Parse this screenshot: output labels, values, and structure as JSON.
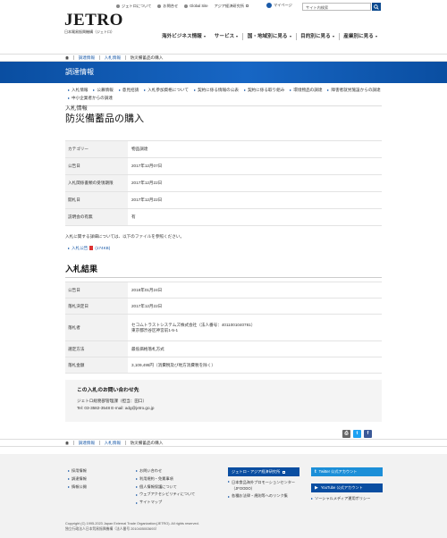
{
  "utility_links": [
    {
      "label": "ジェトロについて"
    },
    {
      "label": "お問合せ"
    },
    {
      "label": "Global Site"
    },
    {
      "label": "アジア経済研究所"
    }
  ],
  "mypage": "マイページ",
  "search": {
    "placeholder": "サイト内検索"
  },
  "logo": {
    "word": "JETRO",
    "subtitle": "日本貿易振興機構（ジェトロ）"
  },
  "main_nav": [
    {
      "label": "海外ビジネス情報"
    },
    {
      "label": "サービス"
    },
    {
      "label": "国・地域別に見る"
    },
    {
      "label": "目的別に見る"
    },
    {
      "label": "産業別に見る"
    }
  ],
  "breadcrumb": [
    "調達情報",
    "入札情報",
    "防災備蓄品の購入"
  ],
  "section_title": "調達情報",
  "subnav": [
    "入札情報",
    "公募情報",
    "意見招請",
    "入札参加資格について",
    "契約に係る情報の公表",
    "契約に係る取り組み",
    "環境物品の調達",
    "障害者就労施設からの調達",
    "中小企業者からの調達"
  ],
  "kicker": "入札情報",
  "page_title": "防災備蓄品の購入",
  "details": [
    {
      "key": "カテゴリー",
      "value": "物品調達"
    },
    {
      "key": "公告日",
      "value": "2017年12月07日"
    },
    {
      "key": "入札関係書類の受領期限",
      "value": "2017年12月22日"
    },
    {
      "key": "開札日",
      "value": "2017年12月22日"
    },
    {
      "key": "説明会の有無",
      "value": "有"
    }
  ],
  "note": "入札に関する詳細については、以下のファイルを参照ください。",
  "pdf_link": {
    "label": "入札公告",
    "size": "(174KB)"
  },
  "results_heading": "入札結果",
  "results": [
    {
      "key": "公告日",
      "value": "2018年01月24日"
    },
    {
      "key": "落札決定日",
      "value": "2017年12月22日"
    },
    {
      "key": "落札者",
      "value": "セコムトラストシステムズ株式会社（法人番号：4011001040781）",
      "value2": "東京都渋谷区神宮前1-5-1"
    },
    {
      "key": "選定方法",
      "value": "最低価格落札方式"
    },
    {
      "key": "落札金額",
      "value": "3,109,495円（消費税及び地方消費税を除く）"
    }
  ],
  "contact": {
    "heading": "この入札のお問い合わせ先",
    "dept": "ジェトロ総務部管理課（担当：田口）",
    "tel": "Tel: 03-3582-3548 E-mail: adg@jetro.go.jp"
  },
  "colors": {
    "brand": "#0a4ea1",
    "link_arrow": "#1a5aa8",
    "twitter": "#1da1f2",
    "facebook": "#3b5998",
    "print": "#666666",
    "youtube": "#e00000"
  },
  "footer": {
    "col1": [
      "採用情報",
      "調達情報",
      "情報公開"
    ],
    "col2": [
      "お問い合わせ",
      "利用規約・免責事項",
      "個人情報保護について",
      "ウェブアクセシビリティについて",
      "サイトマップ"
    ],
    "col3_btn": "ジェトロ・アジア経済研究所",
    "col3_links": [
      "日本食品海外プロモーションセンター（JFOODO）",
      "各種お法律・規則等へのリンク集"
    ],
    "col4_btn1": "Twitter 公式アカウント",
    "col4_btn2": "YouTube 公式アカウント",
    "col4_link": "ソーシャルメディア運用ポリシー",
    "copyright1": "Copyright (C) 1995-2023 Japan External Trade Organization(JETRO). All rights reserved.",
    "copyright2": "独立行政法人日本貿易振興機構（法人番号 2010405003693）"
  }
}
